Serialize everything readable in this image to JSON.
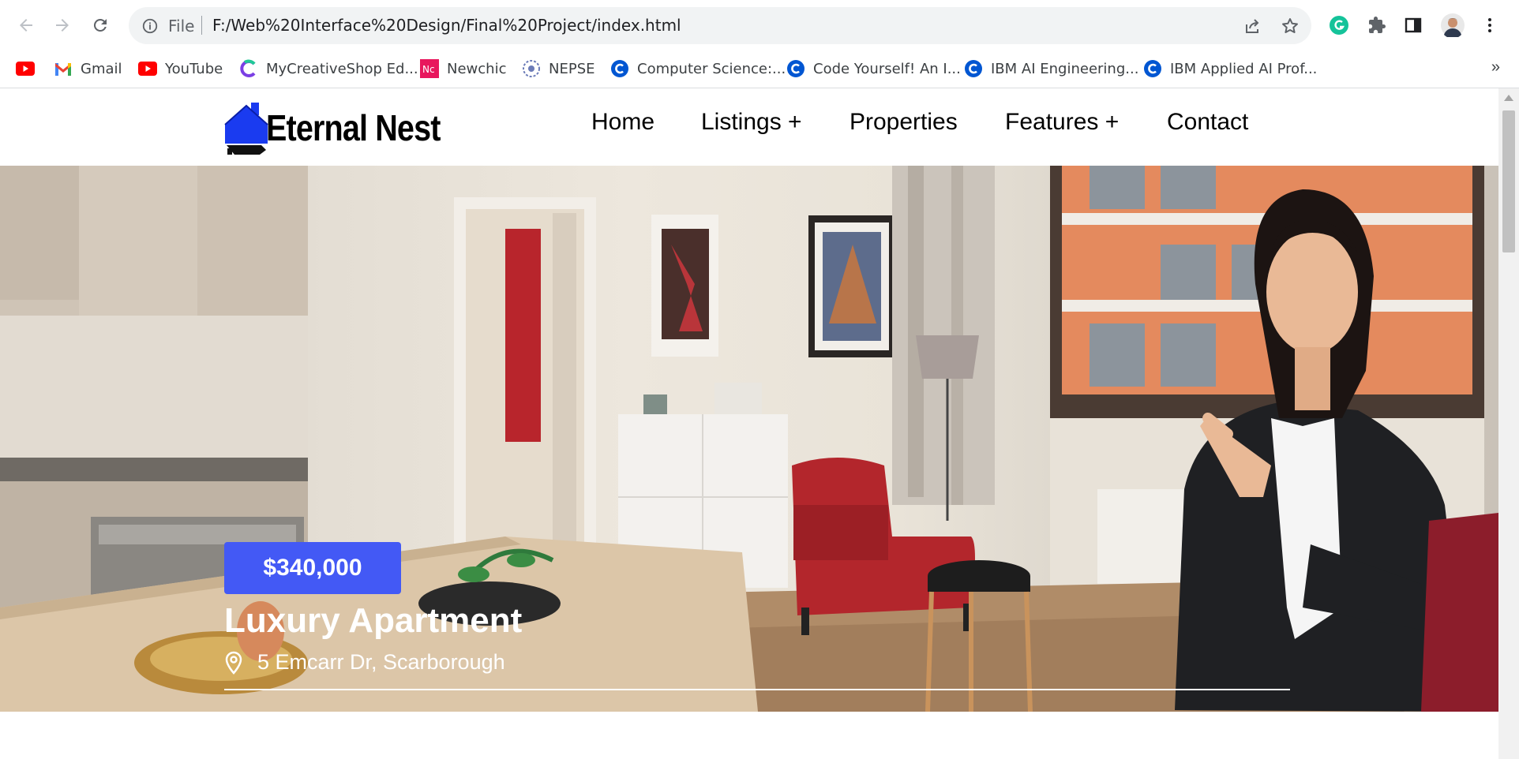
{
  "browser": {
    "scheme_label": "File",
    "url": "F:/Web%20Interface%20Design/Final%20Project/index.html",
    "icons": [
      "back-icon",
      "forward-icon",
      "reload-icon",
      "info-icon",
      "share-icon",
      "star-icon",
      "grammarly-icon",
      "extensions-icon",
      "side-panel-icon",
      "profile-avatar",
      "more-menu-icon"
    ]
  },
  "bookmarks": {
    "items": [
      {
        "label": ""
      },
      {
        "label": "Gmail"
      },
      {
        "label": "YouTube"
      },
      {
        "label": "MyCreativeShop Ed..."
      },
      {
        "label": "Newchic"
      },
      {
        "label": "NEPSE"
      },
      {
        "label": "Computer Science:..."
      },
      {
        "label": "Code Yourself! An I..."
      },
      {
        "label": "IBM AI Engineering..."
      },
      {
        "label": "IBM Applied AI Prof..."
      }
    ],
    "more": "»"
  },
  "site": {
    "logo_text": "Eternal Nest",
    "brand_color": "#1a3bf0",
    "nav": [
      {
        "label": "Home"
      },
      {
        "label": "Listings +"
      },
      {
        "label": "Properties"
      },
      {
        "label": "Features +"
      },
      {
        "label": "Contact"
      }
    ]
  },
  "hero": {
    "price": "$340,000",
    "title": "Luxury Apartment",
    "address": "5 Emcarr Dr, Scarborough",
    "badge_color": "#4359f5"
  }
}
